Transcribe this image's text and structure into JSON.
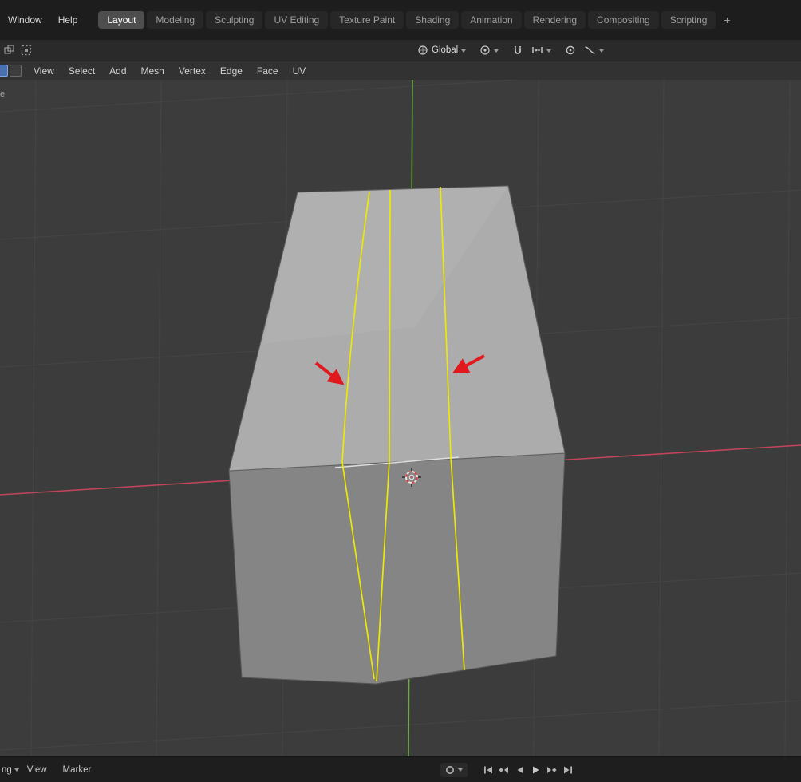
{
  "topbar": {
    "menus": [
      "Window",
      "Help"
    ],
    "tabs": [
      {
        "label": "Layout",
        "active": true
      },
      {
        "label": "Modeling",
        "active": false
      },
      {
        "label": "Sculpting",
        "active": false
      },
      {
        "label": "UV Editing",
        "active": false
      },
      {
        "label": "Texture Paint",
        "active": false
      },
      {
        "label": "Shading",
        "active": false
      },
      {
        "label": "Animation",
        "active": false
      },
      {
        "label": "Rendering",
        "active": false
      },
      {
        "label": "Compositing",
        "active": false
      },
      {
        "label": "Scripting",
        "active": false
      }
    ],
    "add_tab": "+"
  },
  "tool_settings": {
    "orientation_label": "Global"
  },
  "viewport_header": {
    "menus": [
      "View",
      "Select",
      "Add",
      "Mesh",
      "Vertex",
      "Edge",
      "Face",
      "UV"
    ]
  },
  "viewport": {
    "partial_left_label": "e"
  },
  "timeline": {
    "partial_dropdown_label": "ng",
    "menus": [
      "View",
      "Marker"
    ]
  },
  "colors": {
    "axis_x": "#c0455a",
    "axis_y": "#6fa844",
    "selected_edge": "#f0e800",
    "annotation_arrow": "#e0191f",
    "active_tab_bg": "#4e4e4e",
    "cube_top": "#acacac",
    "cube_front": "#8e8e8e"
  }
}
